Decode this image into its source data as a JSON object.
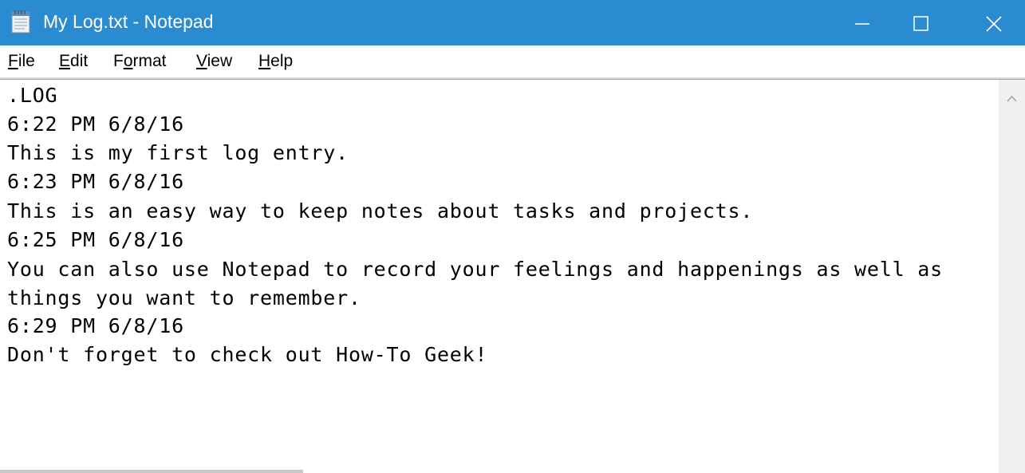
{
  "window": {
    "title": "My Log.txt - Notepad",
    "app_icon": "notepad-icon",
    "accent_color": "#2b8bd0",
    "controls": {
      "minimize_icon": "minimize-icon",
      "maximize_icon": "maximize-icon",
      "close_icon": "close-icon"
    }
  },
  "menu": {
    "file": {
      "mnemonic": "F",
      "rest": "ile"
    },
    "edit": {
      "mnemonic": "E",
      "rest": "dit"
    },
    "format": {
      "pre": "F",
      "mnemonic": "o",
      "rest": "rmat"
    },
    "view": {
      "mnemonic": "V",
      "rest": "iew"
    },
    "help": {
      "mnemonic": "H",
      "rest": "elp"
    }
  },
  "document": {
    "lines": [
      ".LOG",
      "6:22 PM 6/8/16",
      "This is my first log entry.",
      "6:23 PM 6/8/16",
      "This is an easy way to keep notes about tasks and projects.",
      "6:25 PM 6/8/16",
      "You can also use Notepad to record your feelings and happenings as well as",
      "things you want to remember.",
      "6:29 PM 6/8/16",
      "Don't forget to check out How-To Geek!"
    ]
  },
  "scrollbar": {
    "up_icon": "chevron-up-icon"
  }
}
